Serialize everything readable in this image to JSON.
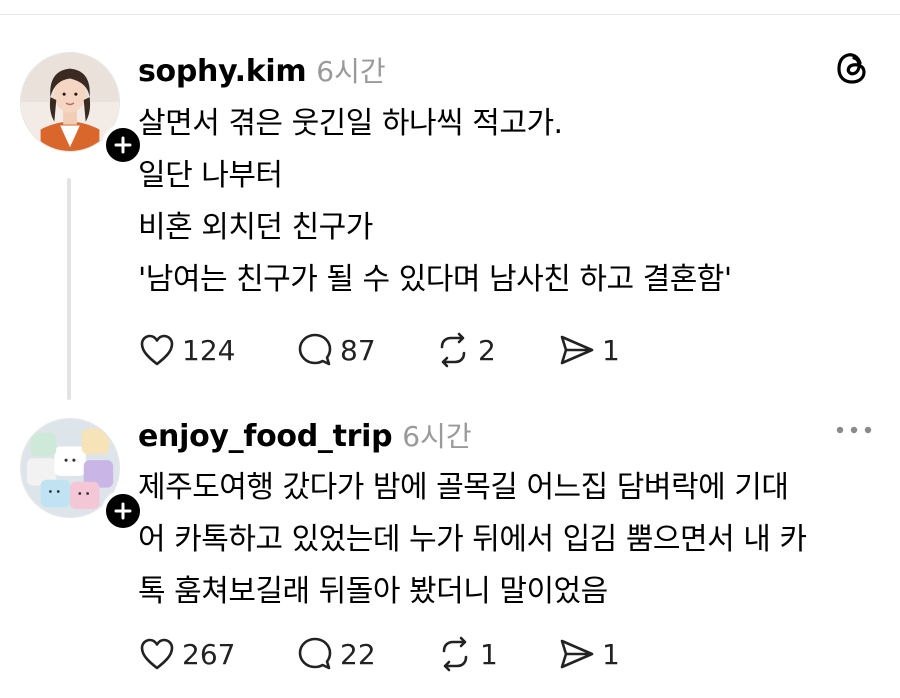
{
  "posts": [
    {
      "username": "sophy.kim",
      "time": "6시간",
      "lines": [
        "살면서 겪은 웃긴일 하나씩 적고가.",
        "일단 나부터",
        "비혼 외치던 친구가",
        "'남여는 친구가 될 수 있다며 남사친 하고 결혼함'"
      ],
      "likes": "124",
      "comments": "87",
      "reposts": "2",
      "shares": "1"
    },
    {
      "username": "enjoy_food_trip",
      "time": "6시간",
      "lines": [
        "제주도여행 갔다가 밤에 골목길 어느집 담벼락에 기대",
        "어 카톡하고 있었는데 누가 뒤에서 입김 뿜으면서 내 카",
        "톡 훔쳐보길래 뒤돌아 봤더니 말이었음"
      ],
      "likes": "267",
      "comments": "22",
      "reposts": "1",
      "shares": "1"
    }
  ],
  "icons": {
    "like": "heart-icon",
    "comment": "comment-bubble-icon",
    "repost": "repost-icon",
    "share": "send-icon",
    "logo": "threads-logo-icon",
    "more": "more-dots-icon",
    "follow": "plus-icon"
  }
}
